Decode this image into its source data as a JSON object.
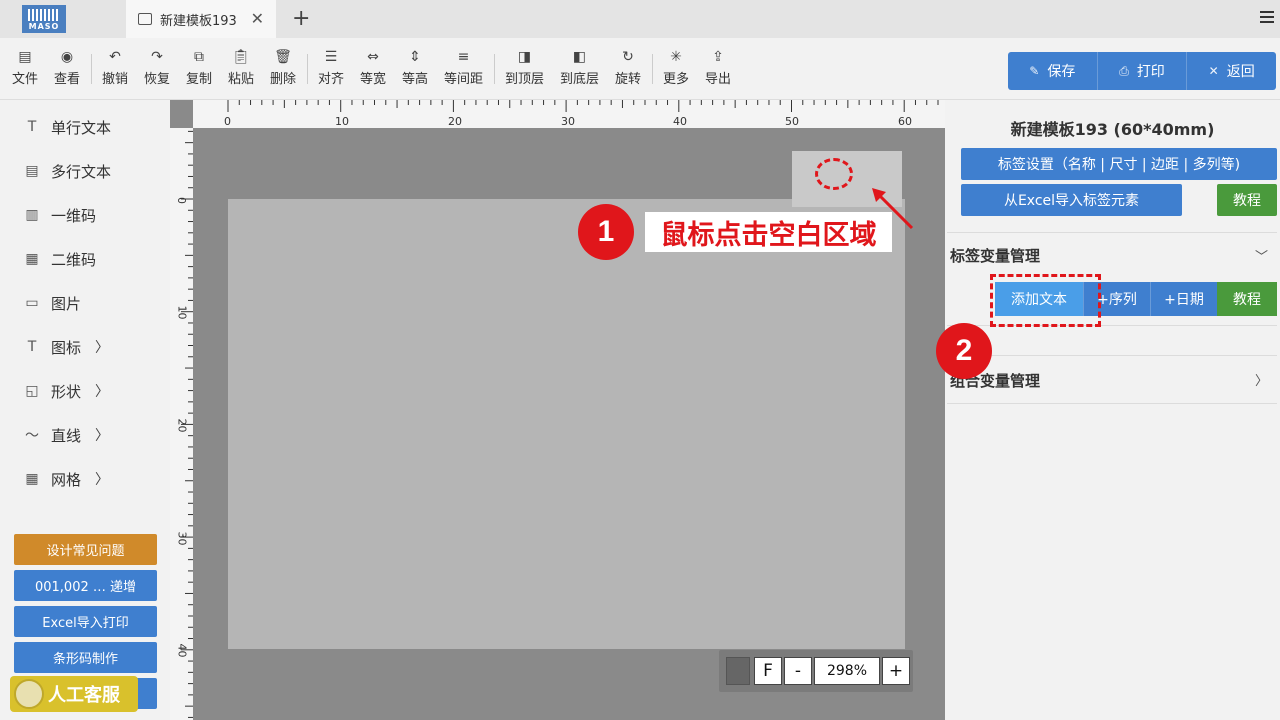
{
  "tab": {
    "title": "新建模板193"
  },
  "logo": {
    "text": "MASO"
  },
  "toolbar": {
    "items": [
      {
        "label": "文件",
        "icon": "file-icon"
      },
      {
        "label": "查看",
        "icon": "eye-icon"
      },
      {
        "label": "撤销",
        "icon": "undo-icon"
      },
      {
        "label": "恢复",
        "icon": "redo-icon"
      },
      {
        "label": "复制",
        "icon": "copy-icon"
      },
      {
        "label": "粘贴",
        "icon": "paste-icon"
      },
      {
        "label": "删除",
        "icon": "trash-icon"
      },
      {
        "label": "对齐",
        "icon": "align-icon"
      },
      {
        "label": "等宽",
        "icon": "equal-width-icon"
      },
      {
        "label": "等高",
        "icon": "equal-height-icon"
      },
      {
        "label": "等间距",
        "icon": "equal-spacing-icon"
      },
      {
        "label": "到顶层",
        "icon": "bring-front-icon"
      },
      {
        "label": "到底层",
        "icon": "send-back-icon"
      },
      {
        "label": "旋转",
        "icon": "rotate-icon"
      },
      {
        "label": "更多",
        "icon": "more-icon"
      },
      {
        "label": "导出",
        "icon": "export-icon"
      }
    ],
    "save": "保存",
    "print": "打印",
    "back": "返回"
  },
  "left": {
    "items": [
      {
        "label": "单行文本",
        "icon": "text-icon"
      },
      {
        "label": "多行文本",
        "icon": "multiline-text-icon"
      },
      {
        "label": "一维码",
        "icon": "barcode-icon"
      },
      {
        "label": "二维码",
        "icon": "qrcode-icon"
      },
      {
        "label": "图片",
        "icon": "image-icon"
      },
      {
        "label": "图标",
        "icon": "text-icon"
      },
      {
        "label": "形状",
        "icon": "shape-icon"
      },
      {
        "label": "直线",
        "icon": "line-icon"
      },
      {
        "label": "网格",
        "icon": "grid-icon"
      }
    ],
    "buttons": [
      "设计常见问题",
      "001,002 … 递增",
      "Excel导入打印",
      "条形码制作"
    ],
    "kefu": "人工客服"
  },
  "ruler": {
    "top": [
      "0",
      "10",
      "20",
      "30",
      "40",
      "50",
      "60"
    ],
    "left": [
      "0",
      "10",
      "20",
      "30",
      "40"
    ]
  },
  "zoom": {
    "f": "F",
    "minus": "-",
    "value": "298%",
    "plus": "+"
  },
  "right": {
    "template_name": "新建模板193 (60*40mm)",
    "label_settings": "标签设置（名称 | 尺寸 | 边距 | 多列等)",
    "import_excel": "从Excel导入标签元素",
    "tutorial": "教程",
    "var_section": "标签变量管理",
    "add_text": "添加文本",
    "add_seq": "+序列",
    "add_date": "+日期",
    "var_tutorial": "教程",
    "combo_section": "组合变量管理"
  },
  "annotations": {
    "step1": "1",
    "step1_text": "鼠标点击空白区域",
    "step2": "2"
  },
  "colors": {
    "blue": "#3f7fcf",
    "green": "#4a9a3c",
    "orange": "#d08a2a",
    "red": "#e0161b"
  }
}
